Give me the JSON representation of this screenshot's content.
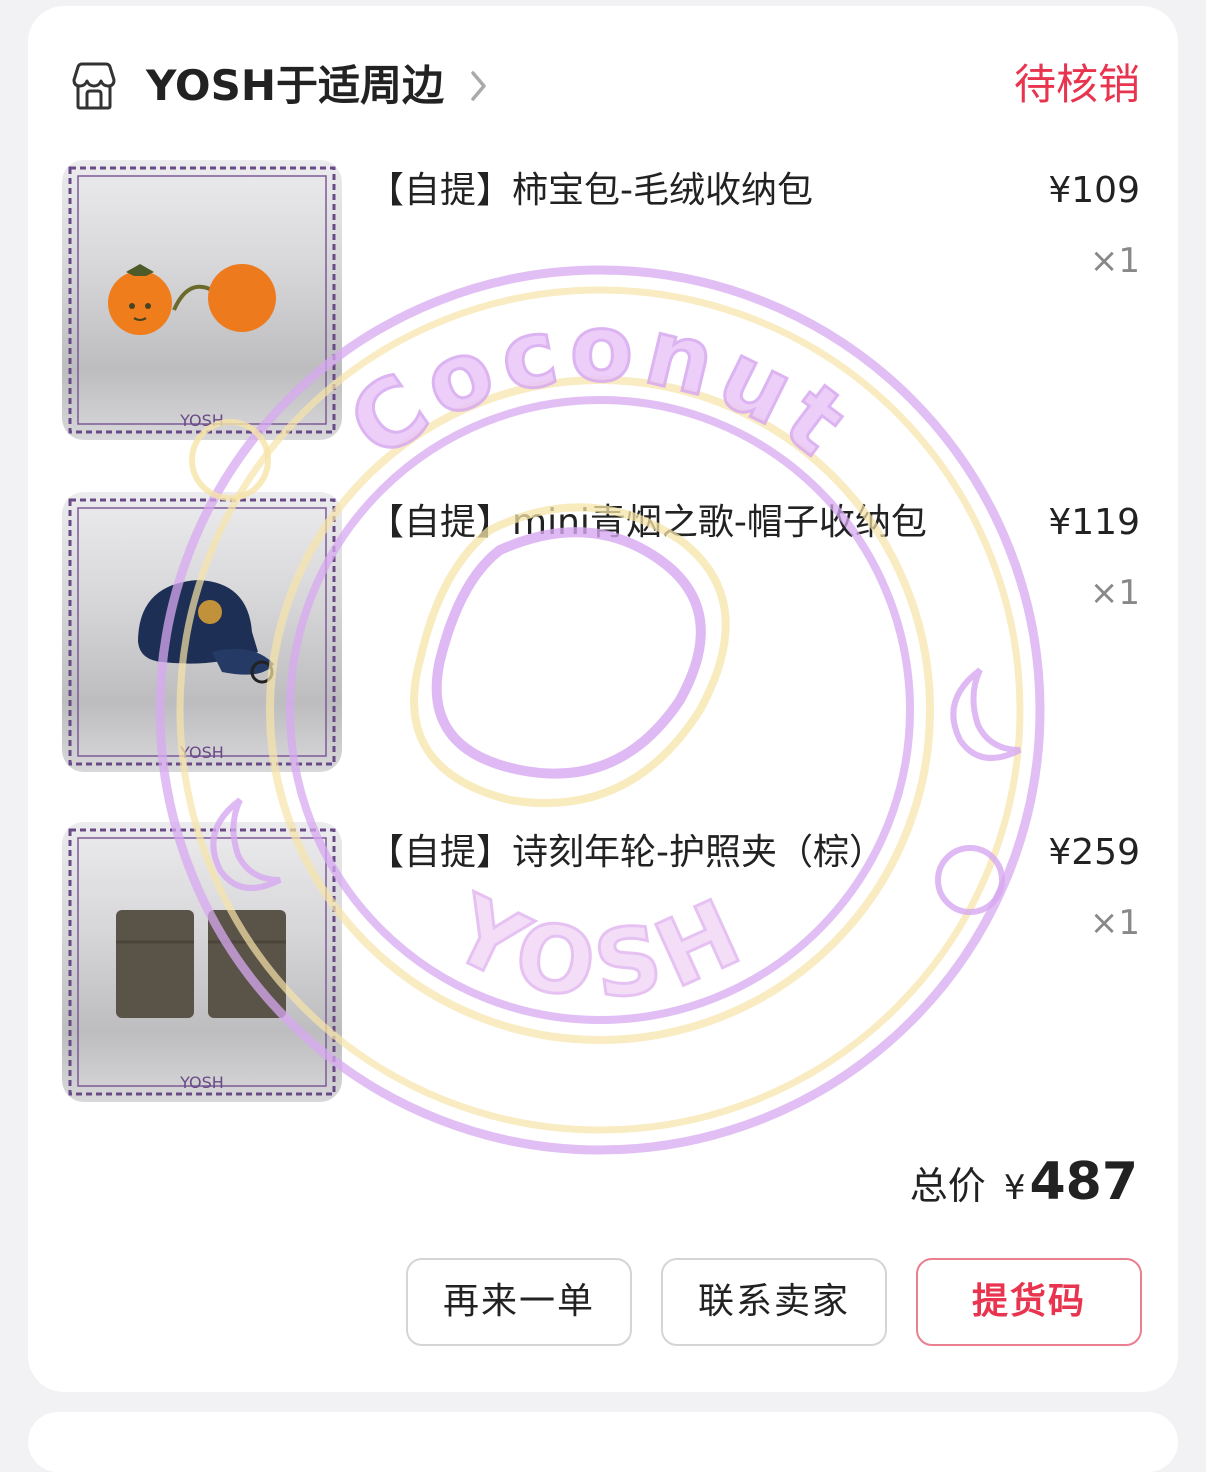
{
  "shop": {
    "name": "YOSH于适周边",
    "status": "待核销",
    "icon": "store-icon"
  },
  "items": [
    {
      "title": "【自提】柿宝包-毛绒收纳包",
      "price": "¥109",
      "quantity": "×1",
      "thumb_icon": "persimmon-pouch-image"
    },
    {
      "title": "【自提】mini青烟之歌-帽子收纳包",
      "price": "¥119",
      "quantity": "×1",
      "thumb_icon": "cap-pouch-image"
    },
    {
      "title": "【自提】诗刻年轮-护照夹（棕）",
      "price": "¥259",
      "quantity": "×1",
      "thumb_icon": "passport-holder-image"
    }
  ],
  "total": {
    "label": "总价",
    "currency": "¥",
    "amount": "487"
  },
  "buttons": {
    "reorder": "再来一单",
    "contact": "联系卖家",
    "pickup_code": "提货码"
  },
  "watermark": {
    "top_text": "Coconut",
    "bottom_text": "YOSH"
  },
  "colors": {
    "accent": "#e8344e",
    "frame_purple": "#5e3a78",
    "watermark_purple": "#d7a8f0",
    "watermark_yellow": "#f6e4a8"
  }
}
